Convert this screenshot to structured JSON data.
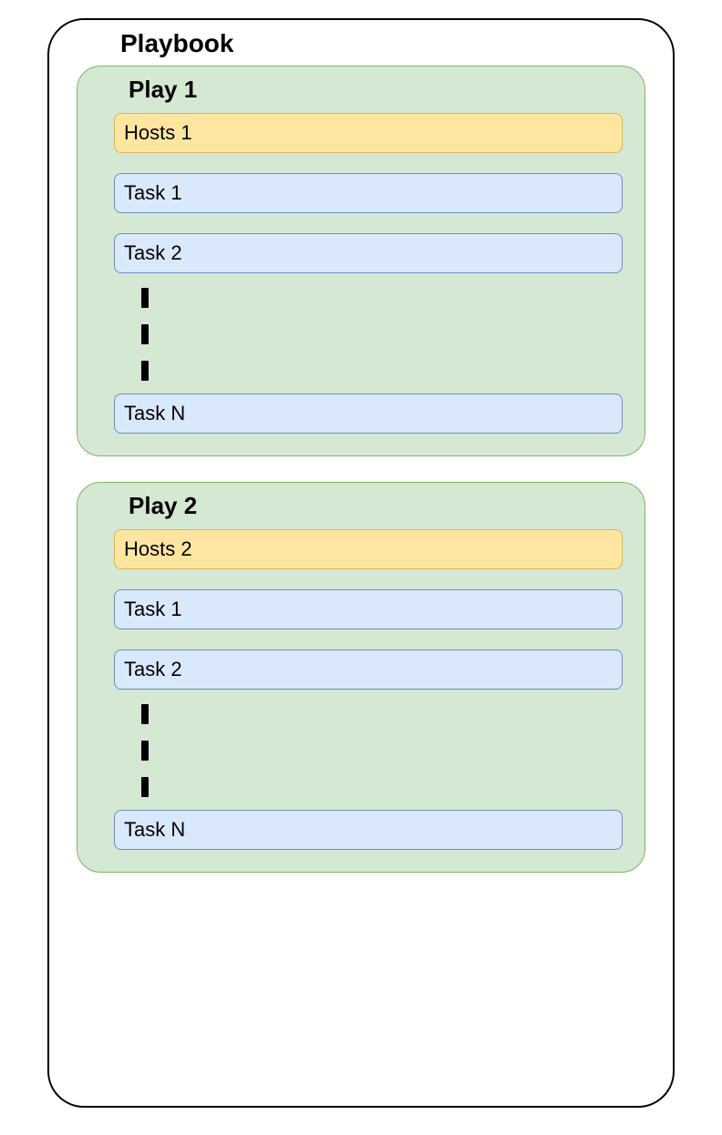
{
  "playbook": {
    "title": "Playbook",
    "plays": [
      {
        "title": "Play 1",
        "hosts": "Hosts 1",
        "tasks_before": [
          "Task 1",
          "Task 2"
        ],
        "task_after": "Task N"
      },
      {
        "title": "Play 2",
        "hosts": "Hosts 2",
        "tasks_before": [
          "Task 1",
          "Task 2"
        ],
        "task_after": "Task N"
      }
    ]
  }
}
